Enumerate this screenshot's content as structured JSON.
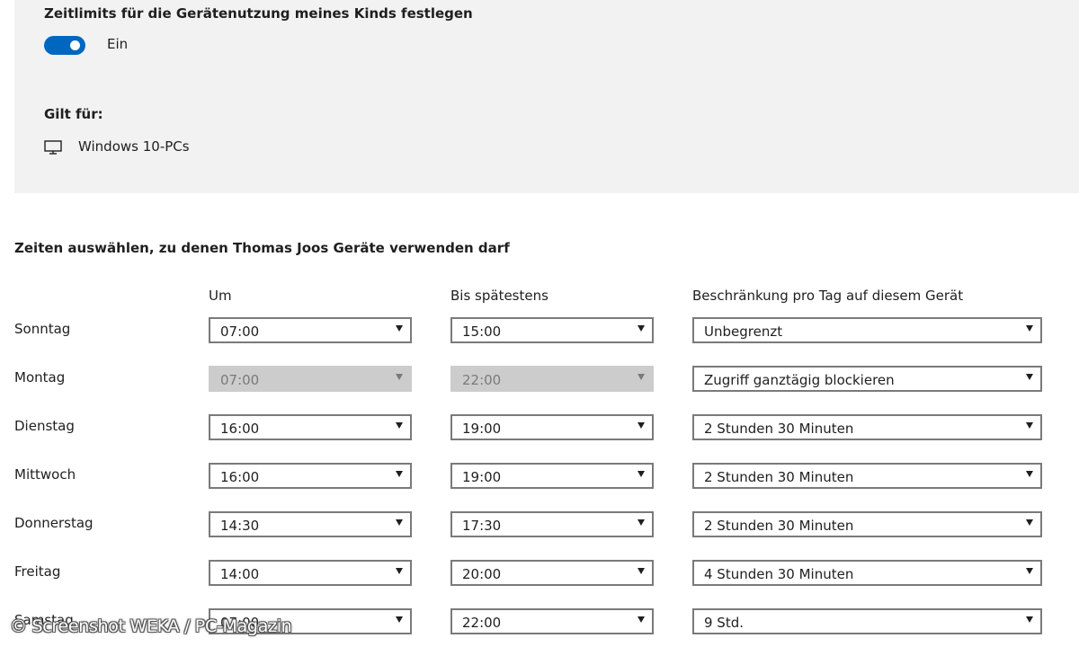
{
  "settings": {
    "heading": "Zeitlimits für die Gerätenutzung meines Kinds festlegen",
    "toggle_state": "Ein",
    "applies_heading": "Gilt für:",
    "device": "Windows 10-PCs",
    "accent_color": "#0067c0"
  },
  "schedule": {
    "title": "Zeiten auswählen, zu denen Thomas Joos Geräte verwenden darf",
    "headers": {
      "from": "Um",
      "until": "Bis spätestens",
      "limit": "Beschränkung pro Tag auf diesem Gerät"
    },
    "days": [
      {
        "name": "Sonntag",
        "from": "07:00",
        "until": "15:00",
        "limit": "Unbegrenzt",
        "times_disabled": false
      },
      {
        "name": "Montag",
        "from": "07:00",
        "until": "22:00",
        "limit": "Zugriff ganztägig blockieren",
        "times_disabled": true
      },
      {
        "name": "Dienstag",
        "from": "16:00",
        "until": "19:00",
        "limit": "2 Stunden 30 Minuten",
        "times_disabled": false
      },
      {
        "name": "Mittwoch",
        "from": "16:00",
        "until": "19:00",
        "limit": "2 Stunden 30 Minuten",
        "times_disabled": false
      },
      {
        "name": "Donnerstag",
        "from": "14:30",
        "until": "17:30",
        "limit": "2 Stunden 30 Minuten",
        "times_disabled": false
      },
      {
        "name": "Freitag",
        "from": "14:00",
        "until": "20:00",
        "limit": "4 Stunden 30 Minuten",
        "times_disabled": false
      },
      {
        "name": "Samstag",
        "from": "07:00",
        "until": "22:00",
        "limit": "9 Std.",
        "times_disabled": false
      }
    ]
  },
  "watermark": "© Screenshot WEKA / PC-Magazin"
}
